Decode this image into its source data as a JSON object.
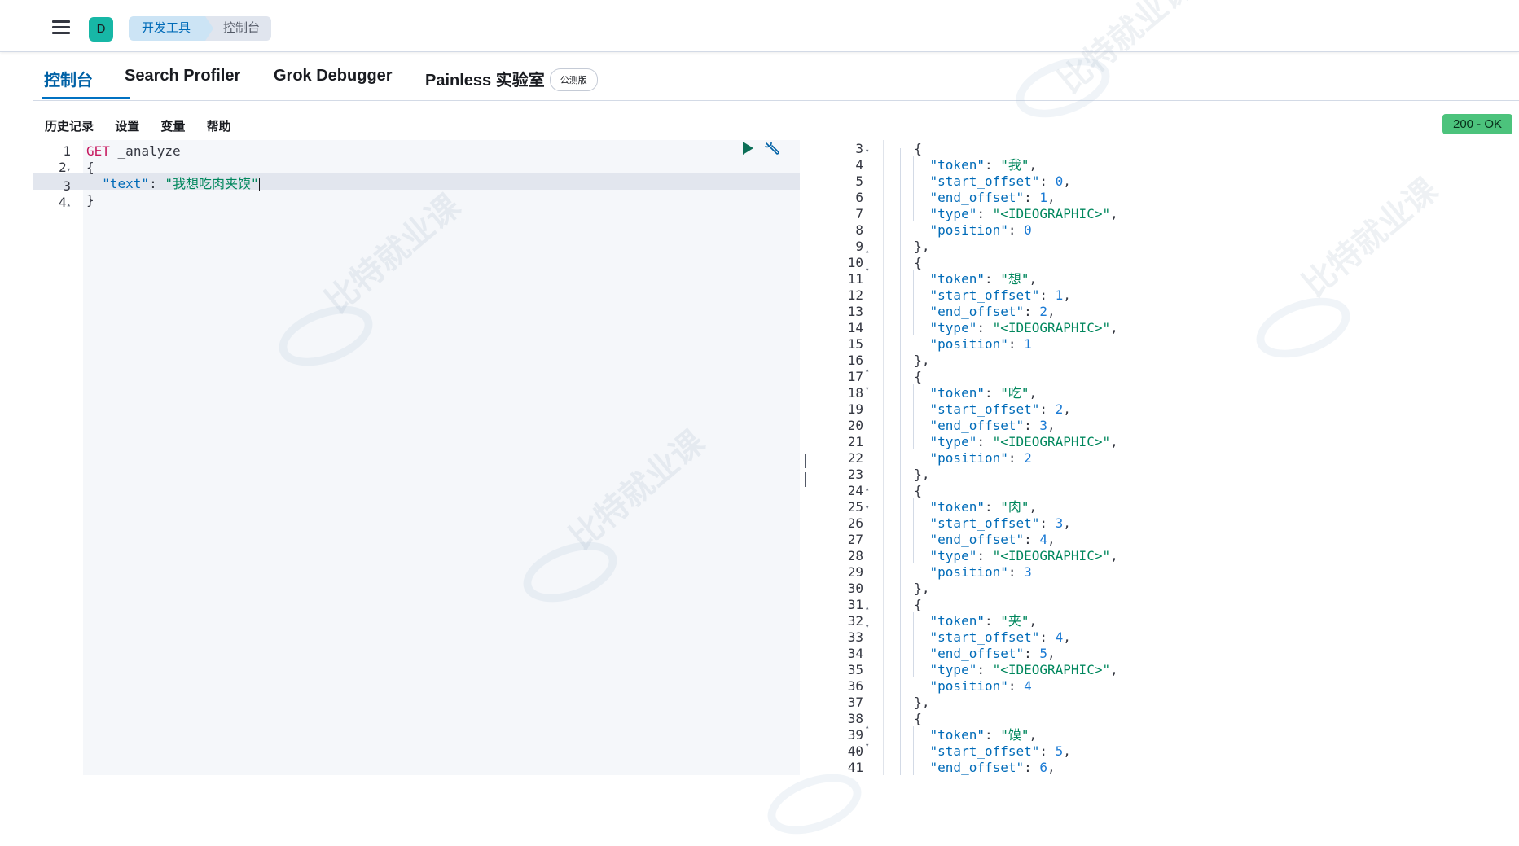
{
  "header": {
    "space_initial": "D",
    "breadcrumbs": [
      "开发工具",
      "控制台"
    ]
  },
  "tabs": [
    {
      "label": "控制台"
    },
    {
      "label": "Search Profiler"
    },
    {
      "label": "Grok Debugger"
    },
    {
      "label": "Painless 实验室",
      "badge": "公测版"
    }
  ],
  "menu": [
    "历史记录",
    "设置",
    "变量",
    "帮助"
  ],
  "status": "200 - OK",
  "request": {
    "line_numbers": [
      "1",
      "2",
      "3",
      "4"
    ],
    "method": "GET",
    "endpoint": "_analyze",
    "open_brace": "{",
    "text_key": "\"text\"",
    "text_value": "\"我想吃肉夹馍\"",
    "close_brace": "}"
  },
  "response": {
    "line_numbers": [
      "3",
      "4",
      "5",
      "6",
      "7",
      "8",
      "9",
      "10",
      "11",
      "12",
      "13",
      "14",
      "15",
      "16",
      "17",
      "18",
      "19",
      "20",
      "21",
      "22",
      "23",
      "24",
      "25",
      "26",
      "27",
      "28",
      "29",
      "30",
      "31",
      "32",
      "33",
      "34",
      "35",
      "36",
      "37",
      "38",
      "39",
      "40",
      "41"
    ],
    "tokens": [
      {
        "token": "\"我\"",
        "start": "0",
        "end": "1",
        "type": "\"<IDEOGRAPHIC>\"",
        "position": "0"
      },
      {
        "token": "\"想\"",
        "start": "1",
        "end": "2",
        "type": "\"<IDEOGRAPHIC>\"",
        "position": "1"
      },
      {
        "token": "\"吃\"",
        "start": "2",
        "end": "3",
        "type": "\"<IDEOGRAPHIC>\"",
        "position": "2"
      },
      {
        "token": "\"肉\"",
        "start": "3",
        "end": "4",
        "type": "\"<IDEOGRAPHIC>\"",
        "position": "3"
      },
      {
        "token": "\"夹\"",
        "start": "4",
        "end": "5",
        "type": "\"<IDEOGRAPHIC>\"",
        "position": "4"
      },
      {
        "token": "\"馍\"",
        "start": "5",
        "end": "6"
      }
    ]
  },
  "watermark": "比特就业课",
  "watermark_url": "www.bitejiuyeke.com"
}
